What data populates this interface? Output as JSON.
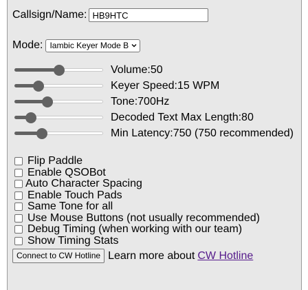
{
  "callsign": {
    "label": "Callsign/Name:",
    "value": "HB9HTC"
  },
  "mode": {
    "label": "Mode:",
    "selected": "Iambic Keyer Mode B"
  },
  "sliders": [
    {
      "label": "Volume:50",
      "fraction": 0.5
    },
    {
      "label": "Keyer Speed:15 WPM",
      "fraction": 0.24
    },
    {
      "label": "Tone:700Hz",
      "fraction": 0.35
    },
    {
      "label": "Decoded Text Max Length:80",
      "fraction": 0.14
    },
    {
      "label": "Min Latency:750 (750 recommended)",
      "fraction": 0.28
    }
  ],
  "options": [
    "Flip Paddle",
    "Enable QSOBot",
    "Auto Character Spacing",
    "Enable Touch Pads",
    "Same Tone for all",
    "Use Mouse Buttons (not usually recommended)",
    "Debug Timing (when working with our team)",
    "Show Timing Stats"
  ],
  "connect": {
    "button_label": "Connect to CW Hotline",
    "learn_text": "Learn more about",
    "link_text": "CW Hotline"
  },
  "colors": {
    "panel": "#e8e8e8",
    "slider": "#626262",
    "link": "#551a8b"
  }
}
